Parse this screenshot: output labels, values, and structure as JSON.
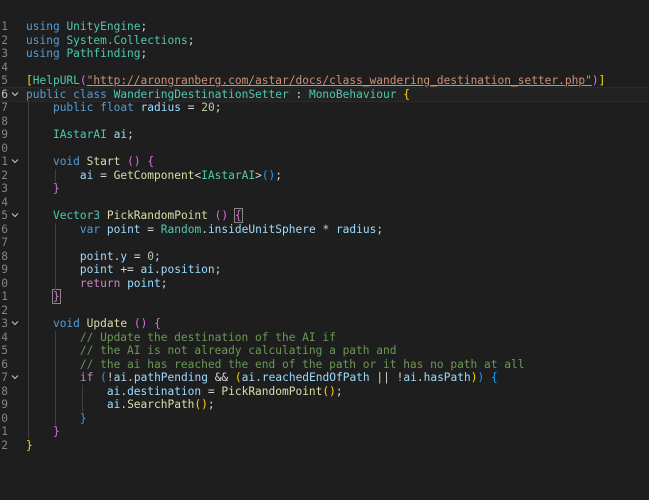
{
  "editor": {
    "language": "csharp",
    "current_line": 6,
    "colors": {
      "background": "#1e1e1e",
      "keyword": "#569cd6",
      "control": "#c586c0",
      "type": "#4ec9b0",
      "function": "#dcdcaa",
      "variable": "#9cdcfe",
      "string": "#ce9178",
      "number": "#b5cea8",
      "comment": "#6a9955",
      "bracket_level1": "#ffd700",
      "bracket_level2": "#da70d6",
      "bracket_level3": "#179fff"
    },
    "lines": [
      {
        "n": "1",
        "fold": "",
        "tokens": [
          [
            "kw",
            "using"
          ],
          [
            "pl",
            " "
          ],
          [
            "ns",
            "UnityEngine"
          ],
          [
            "pl",
            ";"
          ]
        ]
      },
      {
        "n": "2",
        "fold": "",
        "tokens": [
          [
            "kw",
            "using"
          ],
          [
            "pl",
            " "
          ],
          [
            "ns",
            "System.Collections"
          ],
          [
            "pl",
            ";"
          ]
        ]
      },
      {
        "n": "3",
        "fold": "",
        "tokens": [
          [
            "kw",
            "using"
          ],
          [
            "pl",
            " "
          ],
          [
            "ns",
            "Pathfinding"
          ],
          [
            "pl",
            ";"
          ]
        ]
      },
      {
        "n": "4",
        "fold": "",
        "tokens": []
      },
      {
        "n": "5",
        "fold": "",
        "tokens": [
          [
            "b1",
            "["
          ],
          [
            "typ",
            "HelpURL"
          ],
          [
            "b2",
            "("
          ],
          [
            "str link",
            "\"http://arongranberg.com/astar/docs/class_wandering_destination_setter.php\""
          ],
          [
            "b2",
            ")"
          ],
          [
            "b1",
            "]"
          ]
        ]
      },
      {
        "n": "6",
        "fold": "chevron-down",
        "tokens": [
          [
            "kw",
            "public"
          ],
          [
            "pl",
            " "
          ],
          [
            "kw",
            "class"
          ],
          [
            "pl",
            " "
          ],
          [
            "typ",
            "WanderingDestinationSetter"
          ],
          [
            "pl",
            " : "
          ],
          [
            "typ",
            "MonoBehaviour"
          ],
          [
            "pl",
            " "
          ],
          [
            "b1",
            "{"
          ]
        ]
      },
      {
        "n": "7",
        "fold": "",
        "tokens": [
          [
            "pl",
            "    "
          ],
          [
            "kw",
            "public"
          ],
          [
            "pl",
            " "
          ],
          [
            "kw",
            "float"
          ],
          [
            "pl",
            " "
          ],
          [
            "var",
            "radius"
          ],
          [
            "pl",
            " = "
          ],
          [
            "num",
            "20"
          ],
          [
            "pl",
            ";"
          ]
        ]
      },
      {
        "n": "8",
        "fold": "",
        "tokens": []
      },
      {
        "n": "9",
        "fold": "",
        "tokens": [
          [
            "pl",
            "    "
          ],
          [
            "typ",
            "IAstarAI"
          ],
          [
            "pl",
            " "
          ],
          [
            "var",
            "ai"
          ],
          [
            "pl",
            ";"
          ]
        ]
      },
      {
        "n": "0",
        "fold": "",
        "tokens": []
      },
      {
        "n": "1",
        "fold": "chevron-down",
        "tokens": [
          [
            "pl",
            "    "
          ],
          [
            "kw",
            "void"
          ],
          [
            "pl",
            " "
          ],
          [
            "fn",
            "Start"
          ],
          [
            "pl",
            " "
          ],
          [
            "b2",
            "()"
          ],
          [
            "pl",
            " "
          ],
          [
            "b2",
            "{"
          ]
        ]
      },
      {
        "n": "2",
        "fold": "",
        "tokens": [
          [
            "pl",
            "        "
          ],
          [
            "var",
            "ai"
          ],
          [
            "pl",
            " = "
          ],
          [
            "fn",
            "GetComponent"
          ],
          [
            "pl",
            "<"
          ],
          [
            "typ",
            "IAstarAI"
          ],
          [
            "pl",
            ">"
          ],
          [
            "b3",
            "()"
          ],
          [
            "pl",
            ";"
          ]
        ]
      },
      {
        "n": "3",
        "fold": "",
        "tokens": [
          [
            "pl",
            "    "
          ],
          [
            "b2",
            "}"
          ]
        ]
      },
      {
        "n": "4",
        "fold": "",
        "tokens": []
      },
      {
        "n": "5",
        "fold": "chevron-down",
        "tokens": [
          [
            "pl",
            "    "
          ],
          [
            "typ",
            "Vector3"
          ],
          [
            "pl",
            " "
          ],
          [
            "fn",
            "PickRandomPoint"
          ],
          [
            "pl",
            " "
          ],
          [
            "b2",
            "()"
          ],
          [
            "pl",
            " "
          ],
          [
            "b2 cursor-box",
            "{"
          ]
        ]
      },
      {
        "n": "6",
        "fold": "",
        "tokens": [
          [
            "pl",
            "        "
          ],
          [
            "kw",
            "var"
          ],
          [
            "pl",
            " "
          ],
          [
            "var",
            "point"
          ],
          [
            "pl",
            " = "
          ],
          [
            "typ",
            "Random"
          ],
          [
            "pl",
            "."
          ],
          [
            "var",
            "insideUnitSphere"
          ],
          [
            "pl",
            " * "
          ],
          [
            "var",
            "radius"
          ],
          [
            "pl",
            ";"
          ]
        ]
      },
      {
        "n": "7",
        "fold": "",
        "tokens": []
      },
      {
        "n": "8",
        "fold": "",
        "tokens": [
          [
            "pl",
            "        "
          ],
          [
            "var",
            "point"
          ],
          [
            "pl",
            "."
          ],
          [
            "var",
            "y"
          ],
          [
            "pl",
            " = "
          ],
          [
            "num",
            "0"
          ],
          [
            "pl",
            ";"
          ]
        ]
      },
      {
        "n": "9",
        "fold": "",
        "tokens": [
          [
            "pl",
            "        "
          ],
          [
            "var",
            "point"
          ],
          [
            "pl",
            " += "
          ],
          [
            "var",
            "ai"
          ],
          [
            "pl",
            "."
          ],
          [
            "var",
            "position"
          ],
          [
            "pl",
            ";"
          ]
        ]
      },
      {
        "n": "0",
        "fold": "",
        "tokens": [
          [
            "pl",
            "        "
          ],
          [
            "ctl",
            "return"
          ],
          [
            "pl",
            " "
          ],
          [
            "var",
            "point"
          ],
          [
            "pl",
            ";"
          ]
        ]
      },
      {
        "n": "1",
        "fold": "",
        "tokens": [
          [
            "pl",
            "    "
          ],
          [
            "b2 cursor-box",
            "}"
          ]
        ]
      },
      {
        "n": "2",
        "fold": "",
        "tokens": []
      },
      {
        "n": "3",
        "fold": "chevron-down",
        "tokens": [
          [
            "pl",
            "    "
          ],
          [
            "kw",
            "void"
          ],
          [
            "pl",
            " "
          ],
          [
            "fn",
            "Update"
          ],
          [
            "pl",
            " "
          ],
          [
            "b2",
            "()"
          ],
          [
            "pl",
            " "
          ],
          [
            "b2",
            "{"
          ]
        ]
      },
      {
        "n": "4",
        "fold": "",
        "tokens": [
          [
            "pl",
            "        "
          ],
          [
            "cmt",
            "// Update the destination of the AI if"
          ]
        ]
      },
      {
        "n": "5",
        "fold": "",
        "tokens": [
          [
            "pl",
            "        "
          ],
          [
            "cmt",
            "// the AI is not already calculating a path and"
          ]
        ]
      },
      {
        "n": "6",
        "fold": "",
        "tokens": [
          [
            "pl",
            "        "
          ],
          [
            "cmt",
            "// the ai has reached the end of the path or it has no path at all"
          ]
        ]
      },
      {
        "n": "7",
        "fold": "chevron-down",
        "tokens": [
          [
            "pl",
            "        "
          ],
          [
            "ctl",
            "if"
          ],
          [
            "pl",
            " "
          ],
          [
            "b3",
            "("
          ],
          [
            "pl",
            "!"
          ],
          [
            "var",
            "ai"
          ],
          [
            "pl",
            "."
          ],
          [
            "var",
            "pathPending"
          ],
          [
            "pl",
            " && "
          ],
          [
            "b1",
            "("
          ],
          [
            "var",
            "ai"
          ],
          [
            "pl",
            "."
          ],
          [
            "var",
            "reachedEndOfPath"
          ],
          [
            "pl",
            " || !"
          ],
          [
            "var",
            "ai"
          ],
          [
            "pl",
            "."
          ],
          [
            "var",
            "hasPath"
          ],
          [
            "b1",
            ")"
          ],
          [
            "b3",
            ")"
          ],
          [
            "pl",
            " "
          ],
          [
            "b3",
            "{"
          ]
        ]
      },
      {
        "n": "8",
        "fold": "",
        "tokens": [
          [
            "pl",
            "            "
          ],
          [
            "var",
            "ai"
          ],
          [
            "pl",
            "."
          ],
          [
            "var",
            "destination"
          ],
          [
            "pl",
            " = "
          ],
          [
            "fn",
            "PickRandomPoint"
          ],
          [
            "b1",
            "()"
          ],
          [
            "pl",
            ";"
          ]
        ]
      },
      {
        "n": "9",
        "fold": "",
        "tokens": [
          [
            "pl",
            "            "
          ],
          [
            "var",
            "ai"
          ],
          [
            "pl",
            "."
          ],
          [
            "fn",
            "SearchPath"
          ],
          [
            "b1",
            "()"
          ],
          [
            "pl",
            ";"
          ]
        ]
      },
      {
        "n": "0",
        "fold": "",
        "tokens": [
          [
            "pl",
            "        "
          ],
          [
            "b3",
            "}"
          ]
        ]
      },
      {
        "n": "1",
        "fold": "",
        "tokens": [
          [
            "pl",
            "    "
          ],
          [
            "b2",
            "}"
          ]
        ]
      },
      {
        "n": "2",
        "fold": "",
        "tokens": [
          [
            "b1",
            "}"
          ]
        ]
      }
    ]
  }
}
